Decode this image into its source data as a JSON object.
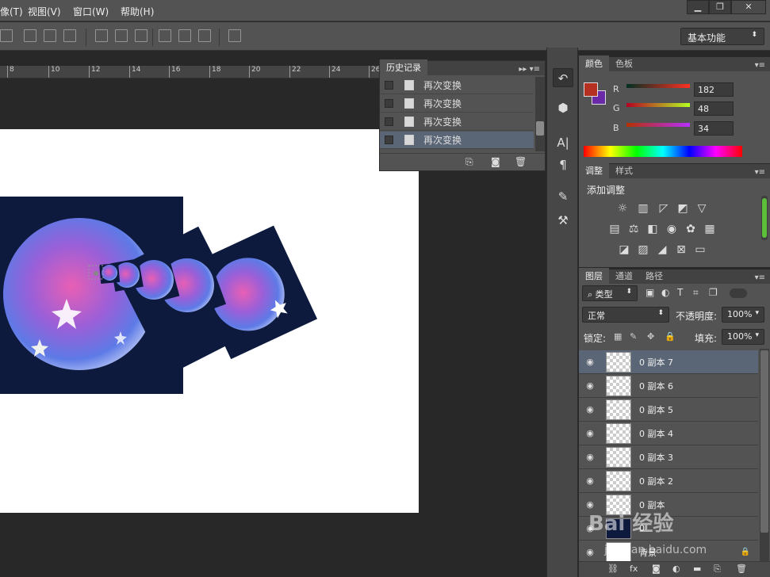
{
  "menubar": {
    "items": [
      "像(T)",
      "视图(V)",
      "窗口(W)",
      "帮助(H)"
    ],
    "win_min": "▁",
    "win_restore": "❐",
    "win_close": "✕"
  },
  "options": {
    "workspace": "基本功能"
  },
  "ruler": {
    "ticks": [
      "8",
      "10",
      "12",
      "14",
      "16",
      "18",
      "20",
      "22",
      "24",
      "26"
    ]
  },
  "history": {
    "tab": "历史记录",
    "items": [
      "再次变换",
      "再次变换",
      "再次变换",
      "再次变换"
    ],
    "selected_index": 3
  },
  "color": {
    "tabs": [
      "颜色",
      "色板"
    ],
    "R": "182",
    "G": "48",
    "B": "34",
    "fg": "#b63022",
    "bg": "#6a2aa8",
    "labels": {
      "r": "R",
      "g": "G",
      "b": "B"
    }
  },
  "adjustments": {
    "tabs": [
      "调整",
      "样式"
    ],
    "title": "添加调整"
  },
  "layers": {
    "tabs": [
      "图层",
      "通道",
      "路径"
    ],
    "filter": "类型",
    "blend": "正常",
    "opacity_label": "不透明度:",
    "opacity": "100%",
    "lock_label": "锁定:",
    "fill_label": "填充:",
    "fill": "100%",
    "items": [
      "0 副本 7",
      "0 副本 6",
      "0 副本 5",
      "0 副本 4",
      "0 副本 3",
      "0 副本 2",
      "0 副本",
      "0",
      "背景"
    ]
  },
  "watermark": {
    "brand": "Bai 经验",
    "url": "jingyan.baidu.com"
  }
}
